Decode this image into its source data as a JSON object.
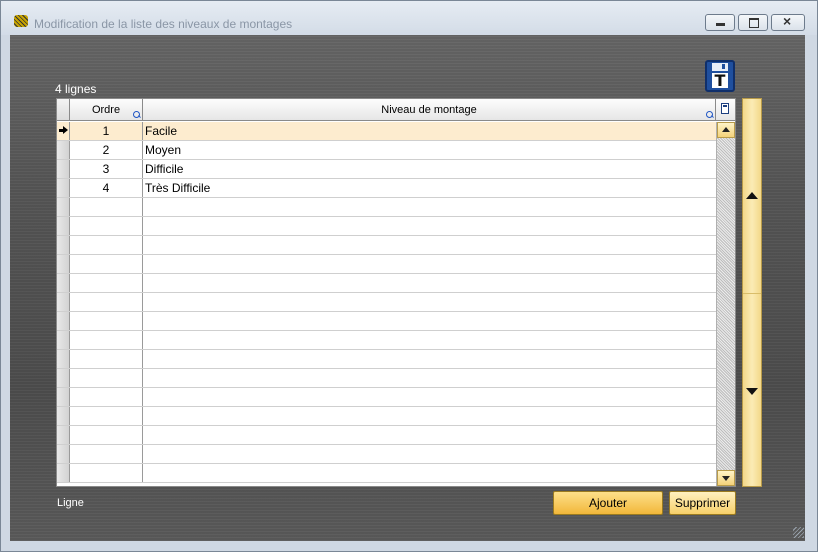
{
  "window": {
    "title": "Modification de la liste des niveaux de montages"
  },
  "summary": {
    "row_count_label": "4 lignes"
  },
  "grid": {
    "columns": [
      {
        "key": "ordre",
        "label": "Ordre"
      },
      {
        "key": "niveau",
        "label": "Niveau de montage"
      }
    ],
    "rows": [
      {
        "ordre": "1",
        "niveau": "Facile"
      },
      {
        "ordre": "2",
        "niveau": "Moyen"
      },
      {
        "ordre": "3",
        "niveau": "Difficile"
      },
      {
        "ordre": "4",
        "niveau": "Très Difficile"
      },
      {
        "ordre": "",
        "niveau": ""
      },
      {
        "ordre": "",
        "niveau": ""
      },
      {
        "ordre": "",
        "niveau": ""
      },
      {
        "ordre": "",
        "niveau": ""
      },
      {
        "ordre": "",
        "niveau": ""
      },
      {
        "ordre": "",
        "niveau": ""
      },
      {
        "ordre": "",
        "niveau": ""
      },
      {
        "ordre": "",
        "niveau": ""
      },
      {
        "ordre": "",
        "niveau": ""
      },
      {
        "ordre": "",
        "niveau": ""
      },
      {
        "ordre": "",
        "niveau": ""
      },
      {
        "ordre": "",
        "niveau": ""
      },
      {
        "ordre": "",
        "niveau": ""
      },
      {
        "ordre": "",
        "niveau": ""
      },
      {
        "ordre": "",
        "niveau": ""
      }
    ]
  },
  "footer": {
    "line_label": "Ligne",
    "add_label": "Ajouter",
    "delete_label": "Supprimer"
  },
  "icons": {
    "save": "floppy-disk-icon",
    "save_letter": "T"
  },
  "colors": {
    "accent": "#f2b73a",
    "selected_row": "#fdeccf",
    "background": "#555555"
  }
}
